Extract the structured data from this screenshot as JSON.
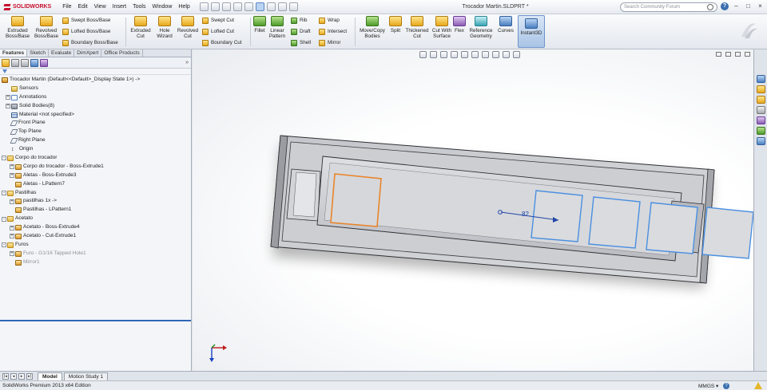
{
  "app": {
    "logo_text": "SOLIDWORKS",
    "document_title": "Trocador Martin.SLDPRT *",
    "menus": [
      "File",
      "Edit",
      "View",
      "Insert",
      "Tools",
      "Window",
      "Help"
    ],
    "search_placeholder": "Search Community Forum",
    "help_label": "?"
  },
  "command_manager": {
    "extruded_boss": "Extruded Boss/Base",
    "revolved_boss": "Revolved Boss/Base",
    "swept_boss": "Swept Boss/Base",
    "lofted_boss": "Lofted Boss/Base",
    "boundary_boss": "Boundary Boss/Base",
    "extruded_cut": "Extruded Cut",
    "hole_wizard": "Hole Wizard",
    "revolved_cut": "Revolved Cut",
    "swept_cut": "Swept Cut",
    "lofted_cut": "Lofted Cut",
    "boundary_cut": "Boundary Cut",
    "fillet": "Fillet",
    "linear_pattern": "Linear Pattern",
    "rib": "Rib",
    "draft": "Draft",
    "shell": "Shell",
    "wrap": "Wrap",
    "intersect": "Intersect",
    "mirror": "Mirror",
    "move_copy_bodies": "Move/Copy Bodies",
    "split": "Split",
    "thickened_cut": "Thickened Cut",
    "cut_with_surface": "Cut With Surface",
    "flex": "Flex",
    "reference_geometry": "Reference Geometry",
    "curves": "Curves",
    "instant3d": "Instant3D"
  },
  "feature_manager": {
    "tabs": [
      "Features",
      "Sketch",
      "Evaluate",
      "DimXpert",
      "Office Products"
    ],
    "expand_label": "»",
    "tree": [
      {
        "label": "Trocador Martin  (Default<<Default>_Display State 1>) ->",
        "indent": 0,
        "icon": "part",
        "exp": ""
      },
      {
        "label": "Sensors",
        "indent": 1,
        "icon": "sensor",
        "exp": ""
      },
      {
        "label": "Annotations",
        "indent": 1,
        "icon": "anno",
        "exp": "+"
      },
      {
        "label": "Solid Bodies(8)",
        "indent": 1,
        "icon": "solid",
        "exp": "+"
      },
      {
        "label": "Material <not specified>",
        "indent": 1,
        "icon": "mat",
        "exp": ""
      },
      {
        "label": "Front Plane",
        "indent": 1,
        "icon": "plane",
        "exp": ""
      },
      {
        "label": "Top Plane",
        "indent": 1,
        "icon": "plane",
        "exp": ""
      },
      {
        "label": "Right Plane",
        "indent": 1,
        "icon": "plane",
        "exp": ""
      },
      {
        "label": "Origin",
        "indent": 1,
        "icon": "origin",
        "exp": ""
      },
      {
        "label": "Corpo do trocador",
        "indent": 0,
        "icon": "folder",
        "exp": "-"
      },
      {
        "label": "Corpo do trocador - Boss-Extrude1",
        "indent": 2,
        "icon": "feat",
        "exp": "+"
      },
      {
        "label": "Aletas - Boss-Extrude3",
        "indent": 2,
        "icon": "feat",
        "exp": "+"
      },
      {
        "label": "Aletas - LPattern7",
        "indent": 2,
        "icon": "feat",
        "exp": ""
      },
      {
        "label": "Pastilhas",
        "indent": 0,
        "icon": "folder",
        "exp": "-"
      },
      {
        "label": "pastilhas 1x ->",
        "indent": 2,
        "icon": "feat",
        "exp": "+"
      },
      {
        "label": "Pastilhas - LPattern1",
        "indent": 2,
        "icon": "feat",
        "exp": ""
      },
      {
        "label": "Acetato",
        "indent": 0,
        "icon": "folder",
        "exp": "-"
      },
      {
        "label": "Acetato - Boss-Extrude4",
        "indent": 2,
        "icon": "feat",
        "exp": "+"
      },
      {
        "label": "Acetato - Cut-Extrude1",
        "indent": 2,
        "icon": "feat",
        "exp": "+"
      },
      {
        "label": "Furos",
        "indent": 0,
        "icon": "folder",
        "exp": "-"
      },
      {
        "label": "Furo - G1/16 Tapped Hole1",
        "indent": 2,
        "icon": "feat",
        "exp": "+",
        "dim": true
      },
      {
        "label": "Mirror1",
        "indent": 2,
        "icon": "feat",
        "exp": "",
        "dim": true
      }
    ]
  },
  "viewport": {
    "dimension_label": "82"
  },
  "bottom_tabs": [
    "Model",
    "Motion Study 1"
  ],
  "status": {
    "edition": "SolidWorks Premium 2013 x64 Edition",
    "units": "MMGS",
    "units_arrow": "▾"
  },
  "colors": {
    "accent": "#2f67b5",
    "selection_blue": "#4a8fe0",
    "highlight_orange": "#e8852a",
    "part_gray": "#c9cace"
  }
}
